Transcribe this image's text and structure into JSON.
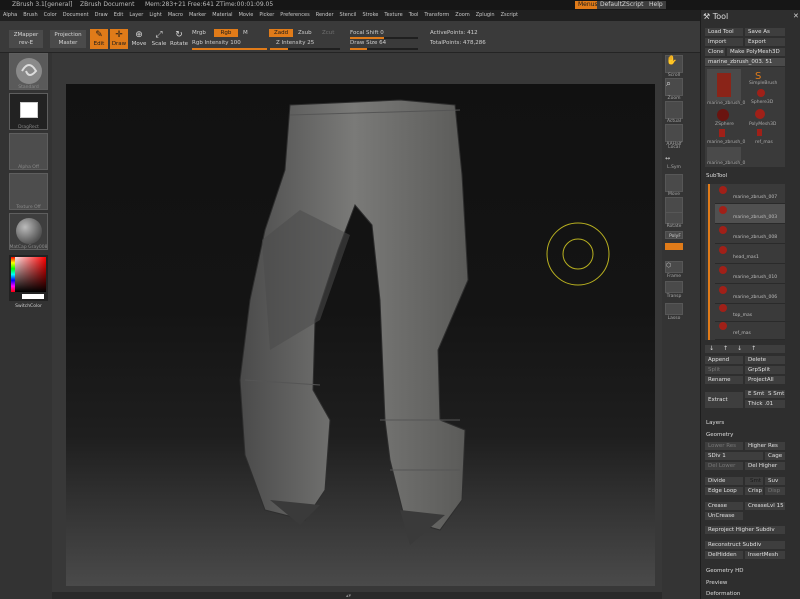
{
  "titlebar": {
    "app": "ZBrush 3.1[general]",
    "doc": "ZBrush Document",
    "mem": "Mem:283+21 Free:641 ZTime:00:01:09.05",
    "menus_btn": "Menus",
    "script_btn": "DefaultZScript",
    "help_btn": "Help"
  },
  "menubar": [
    "Alpha",
    "Brush",
    "Color",
    "Document",
    "Draw",
    "Edit",
    "Layer",
    "Light",
    "Macro",
    "Marker",
    "Material",
    "Movie",
    "Picker",
    "Preferences",
    "Render",
    "Stencil",
    "Stroke",
    "Texture",
    "Tool",
    "Transform",
    "Zoom",
    "Zplugin",
    "Zscript"
  ],
  "toolbar": {
    "zmapper": "ZMapper",
    "zmapper2": "rev-E",
    "projection": "Projection",
    "master": "Master",
    "edit": "Edit",
    "draw": "Draw",
    "move": "Move",
    "scale": "Scale",
    "rotate": "Rotate",
    "mrgb": "Mrgb",
    "rgb": "Rgb",
    "m": "M",
    "rgb_intensity": "Rgb Intensity 100",
    "zadd": "Zadd",
    "zsub": "Zsub",
    "zcut": "Zcut",
    "z_intensity": "Z Intensity 25",
    "focal_shift": "Focal Shift 0",
    "draw_size": "Draw Size 64",
    "active_points": "ActivePoints: 412",
    "total_points": "TotalPoints: 478,286"
  },
  "leftshelf": {
    "standard": "Standard",
    "dragrect": "DragRect",
    "alpha": "Alpha Off",
    "texture": "Texture Off",
    "matcap": "MatCap Gray008",
    "switchcolor": "SwitchColor"
  },
  "rightshelf": [
    "Scroll",
    "Zoom",
    "Actual",
    "AAHalf",
    "Local",
    "L.Sym",
    "Move",
    "Scale",
    "Rotate",
    "PolyF",
    "Frame",
    "Transp",
    "Lasso"
  ],
  "toolpanel": {
    "title": "Tool",
    "load": "Load Tool",
    "saveas": "Save As",
    "import": "Import",
    "export": "Export",
    "clone": "Clone",
    "makepoly": "Make PolyMesh3D",
    "current": "marine_zbrush_003. 51",
    "tools": [
      "marine_zbrush_0",
      "SimpleBrush",
      "Sphere3D",
      "ZSphere",
      "PolyMesh3D",
      "marine_zbrush_0",
      "ref_mas",
      "marine_zbrush_0"
    ],
    "subtool_title": "SubTool",
    "subtools": [
      "marine_zbrush_007",
      "marine_zbrush_003",
      "marine_zbrush_008",
      "head_mas1",
      "marine_zbrush_010",
      "marine_zbrush_006",
      "top_mas",
      "ref_mas"
    ],
    "append": "Append",
    "delete": "Delete",
    "split": "Split",
    "grpsplit": "GrpSplit",
    "rename": "Rename",
    "projectall": "ProjectAll",
    "extract": "Extract",
    "esmt": "E Smt",
    "ssmt": "S Smt",
    "thick": "Thick .01",
    "layers": "Layers",
    "geometry": "Geometry",
    "lowerres": "Lower Res",
    "higherres": "Higher Res",
    "sdiv": "SDiv 1",
    "cage": "Cage",
    "dellower": "Del Lower",
    "delhigher": "Del Higher",
    "divide": "Divide",
    "smt": "Smt",
    "suv": "Suv",
    "edgeloop": "Edge Loop",
    "crisp": "Crisp",
    "disp": "Disp",
    "crease": "Crease",
    "creaselvl": "CreaseLvl 15",
    "uncrease": "UnCrease",
    "reproject": "Reproject Higher Subdiv",
    "reconstruct": "Reconstruct Subdiv",
    "delhidden": "DelHidden",
    "insertmesh": "InsertMesh",
    "geometryhd": "Geometry HD",
    "preview": "Preview",
    "deformation": "Deformation"
  },
  "colors": {
    "accent": "#e07b19",
    "background": "#2a2a2a",
    "panel": "#2e2e2e"
  }
}
